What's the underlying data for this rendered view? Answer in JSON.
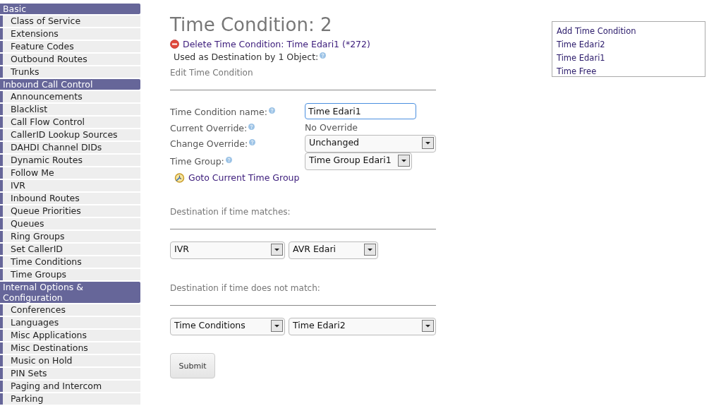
{
  "sidebar": [
    {
      "kind": "header",
      "label": "Basic"
    },
    {
      "kind": "item",
      "label": "Class of Service"
    },
    {
      "kind": "item",
      "label": "Extensions"
    },
    {
      "kind": "item",
      "label": "Feature Codes"
    },
    {
      "kind": "item",
      "label": "Outbound Routes"
    },
    {
      "kind": "item",
      "label": "Trunks"
    },
    {
      "kind": "header",
      "label": "Inbound Call Control"
    },
    {
      "kind": "item",
      "label": "Announcements"
    },
    {
      "kind": "item",
      "label": "Blacklist"
    },
    {
      "kind": "item",
      "label": "Call Flow Control"
    },
    {
      "kind": "item",
      "label": "CallerID Lookup Sources"
    },
    {
      "kind": "item",
      "label": "DAHDI Channel DIDs"
    },
    {
      "kind": "item",
      "label": "Dynamic Routes"
    },
    {
      "kind": "item",
      "label": "Follow Me"
    },
    {
      "kind": "item",
      "label": "IVR"
    },
    {
      "kind": "item",
      "label": "Inbound Routes"
    },
    {
      "kind": "item",
      "label": "Queue Priorities"
    },
    {
      "kind": "item",
      "label": "Queues"
    },
    {
      "kind": "item",
      "label": "Ring Groups"
    },
    {
      "kind": "item",
      "label": "Set CallerID"
    },
    {
      "kind": "item",
      "label": "Time Conditions"
    },
    {
      "kind": "item",
      "label": "Time Groups"
    },
    {
      "kind": "header",
      "label": "Internal Options & Configuration"
    },
    {
      "kind": "item",
      "label": "Conferences"
    },
    {
      "kind": "item",
      "label": "Languages"
    },
    {
      "kind": "item",
      "label": "Misc Applications"
    },
    {
      "kind": "item",
      "label": "Misc Destinations"
    },
    {
      "kind": "item",
      "label": "Music on Hold"
    },
    {
      "kind": "item",
      "label": "PIN Sets"
    },
    {
      "kind": "item",
      "label": "Paging and Intercom"
    },
    {
      "kind": "item",
      "label": "Parking"
    }
  ],
  "title": "Time Condition: 2",
  "delete_link": "Delete Time Condition: Time Edari1 (*272)",
  "used_as": "Used as Destination by 1 Object:",
  "section": "Edit Time Condition",
  "form": {
    "name": {
      "label": "Time Condition name:",
      "value": "Time Edari1"
    },
    "current_override": {
      "label": "Current Override:",
      "value": "No Override"
    },
    "change_override": {
      "label": "Change Override:",
      "value": "Unchanged"
    },
    "time_group": {
      "label": "Time Group:",
      "value": "Time Group Edari1"
    },
    "goto_link": "Goto Current Time Group"
  },
  "destinations": [
    {
      "heading": "Destination if time matches:",
      "type": "IVR",
      "target": "AVR Edari"
    },
    {
      "heading": "Destination if time does not match:",
      "type": "Time Conditions",
      "target": "Time Edari2"
    }
  ],
  "submit": "Submit",
  "right_menu": [
    "Add Time Condition",
    "Time Edari2",
    "Time Edari1",
    "Time Free"
  ]
}
